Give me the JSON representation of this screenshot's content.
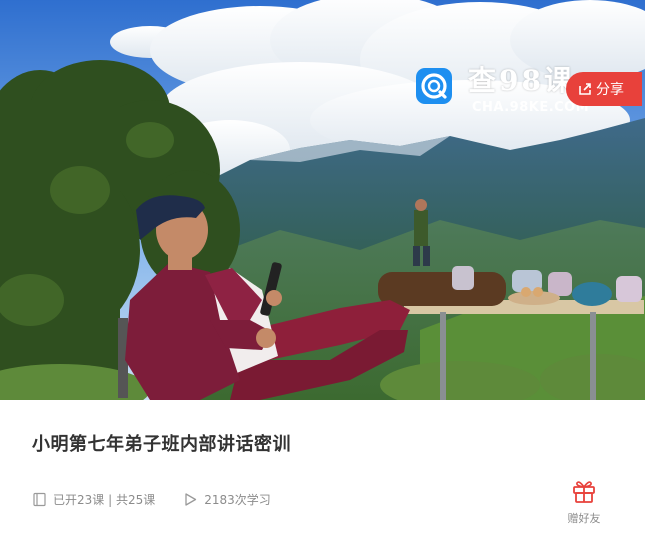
{
  "watermark": {
    "title": "查98课",
    "url": "CHA.98KE.COM"
  },
  "header": {
    "share_label": "分享"
  },
  "course": {
    "title": "小明第七年弟子班内部讲话密训",
    "lessons_text": "已开23课 | 共25课",
    "learners_text": "2183次学习",
    "gift_label": "赠好友"
  },
  "colors": {
    "accent": "#e8413b",
    "title_text": "#333333",
    "meta_text": "#8c8c8c"
  },
  "icons": {
    "share": "share-icon",
    "lessons": "book-icon",
    "learners": "play-icon",
    "gift": "gift-icon"
  }
}
